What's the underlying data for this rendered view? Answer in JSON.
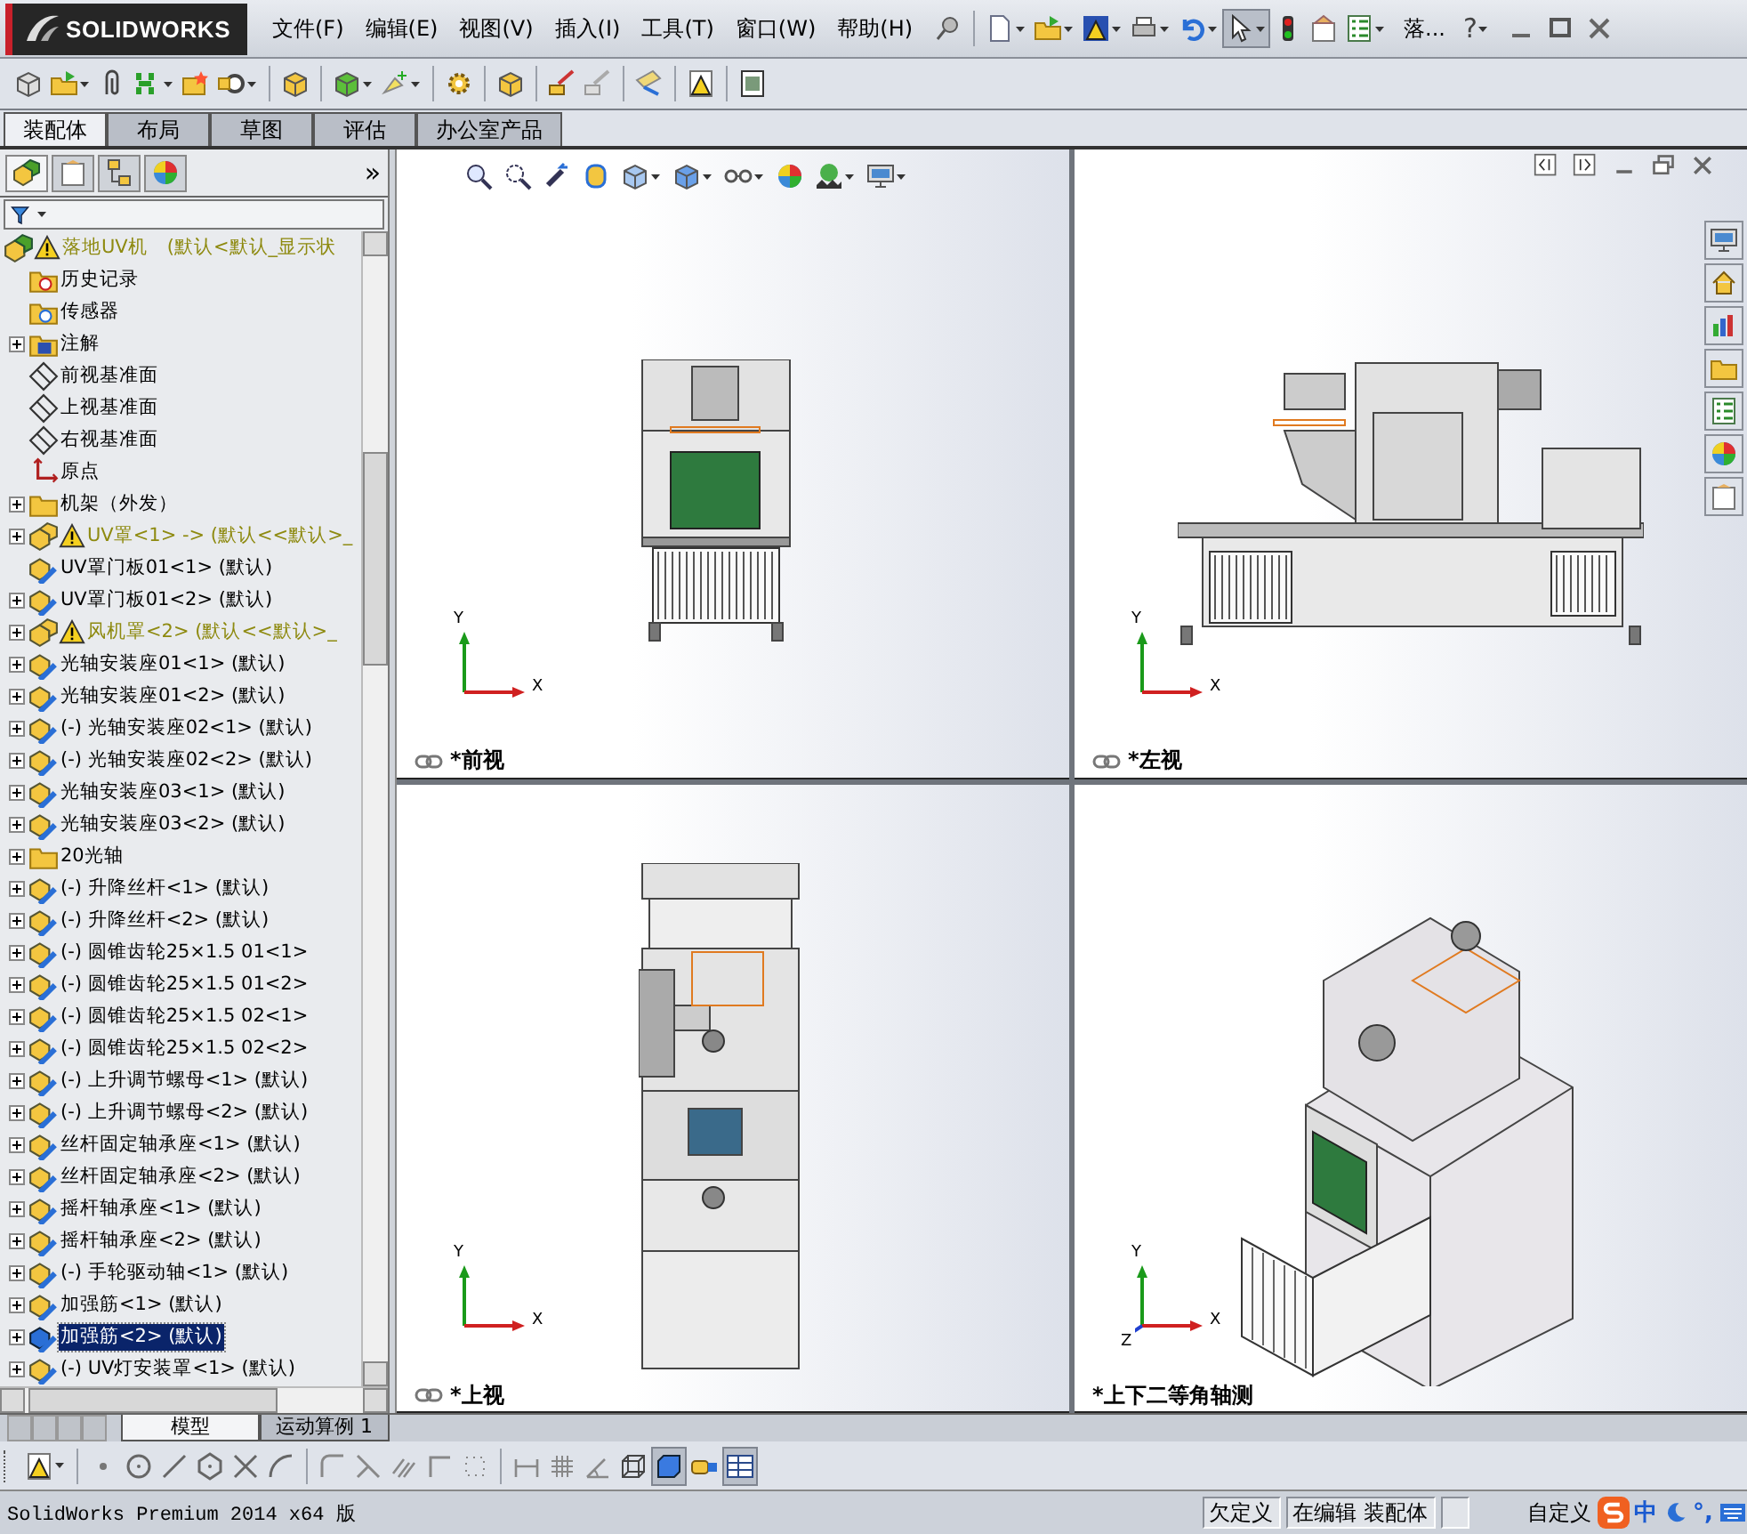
{
  "app": {
    "logo": "SOLIDWORKS"
  },
  "menu": [
    "文件(F)",
    "编辑(E)",
    "视图(V)",
    "插入(I)",
    "工具(T)",
    "窗口(W)",
    "帮助(H)"
  ],
  "title_toolbar": [
    [
      {
        "kind": "pin",
        "dropdown": false,
        "pressed": false
      }
    ],
    [
      {
        "kind": "doc",
        "dropdown": true,
        "pressed": false
      },
      {
        "kind": "open-folder",
        "dropdown": true,
        "pressed": false
      },
      {
        "kind": "save-warn",
        "dropdown": true,
        "pressed": false
      },
      {
        "kind": "print",
        "dropdown": true,
        "pressed": false
      },
      {
        "kind": "undo",
        "dropdown": true,
        "pressed": false
      },
      {
        "kind": "pointer",
        "dropdown": true,
        "pressed": true
      },
      {
        "kind": "traffic",
        "dropdown": false,
        "pressed": false
      },
      {
        "kind": "options",
        "dropdown": false,
        "pressed": false
      },
      {
        "kind": "list",
        "dropdown": true,
        "pressed": false
      }
    ]
  ],
  "document_title": "落...",
  "help": "?",
  "command_toolbar": [
    [
      {
        "kind": "gray-box",
        "dropdown": false,
        "pressed": false
      },
      {
        "kind": "open-folder",
        "dropdown": true,
        "pressed": false
      },
      {
        "kind": "clip",
        "dropdown": false,
        "pressed": false
      },
      {
        "kind": "pattern",
        "dropdown": true,
        "pressed": false
      },
      {
        "kind": "star-folder",
        "dropdown": false,
        "pressed": false
      },
      {
        "kind": "mate",
        "dropdown": true,
        "pressed": false
      }
    ],
    [
      {
        "kind": "yellow-cube",
        "dropdown": false,
        "pressed": false
      }
    ],
    [
      {
        "kind": "green-cube",
        "dropdown": true,
        "pressed": false
      },
      {
        "kind": "spark",
        "dropdown": true,
        "pressed": false
      }
    ],
    [
      {
        "kind": "gear",
        "dropdown": false,
        "pressed": false
      }
    ],
    [
      {
        "kind": "yellow-cube",
        "dropdown": false,
        "pressed": false
      }
    ],
    [
      {
        "kind": "move",
        "dropdown": false,
        "pressed": false
      },
      {
        "kind": "move-gray",
        "dropdown": false,
        "pressed": false
      }
    ],
    [
      {
        "kind": "measure",
        "dropdown": false,
        "pressed": false
      }
    ],
    [
      {
        "kind": "warn-doc",
        "dropdown": false,
        "pressed": false
      }
    ],
    [
      {
        "kind": "screenshot",
        "dropdown": false,
        "pressed": false
      }
    ]
  ],
  "command_tabs": [
    {
      "label": "装配体",
      "selected": true
    },
    {
      "label": "布局",
      "selected": false
    },
    {
      "label": "草图",
      "selected": false
    },
    {
      "label": "评估",
      "selected": false
    },
    {
      "label": "办公室产品",
      "selected": false
    }
  ],
  "panel_tabs": [
    {
      "kind": "assembly-root",
      "selected": true
    },
    {
      "kind": "notes",
      "selected": false
    },
    {
      "kind": "config",
      "selected": false
    },
    {
      "kind": "sphere",
      "selected": false
    }
  ],
  "panel_more": "»",
  "tree": {
    "label": "落地UV机　(默认<默认_显示状",
    "kind": "assembly-root",
    "warning": true,
    "children": [
      {
        "label": "历史记录",
        "kind": "history",
        "expandable": false,
        "warning": false,
        "selected": false
      },
      {
        "label": "传感器",
        "kind": "sensor",
        "expandable": false,
        "warning": false,
        "selected": false
      },
      {
        "label": "注解",
        "kind": "annotation",
        "expandable": true,
        "warning": false,
        "selected": false
      },
      {
        "label": "前视基准面",
        "kind": "plane",
        "expandable": false,
        "warning": false,
        "selected": false
      },
      {
        "label": "上视基准面",
        "kind": "plane",
        "expandable": false,
        "warning": false,
        "selected": false
      },
      {
        "label": "右视基准面",
        "kind": "plane",
        "expandable": false,
        "warning": false,
        "selected": false
      },
      {
        "label": "原点",
        "kind": "origin",
        "expandable": false,
        "warning": false,
        "selected": false
      },
      {
        "label": "机架（外发）",
        "kind": "folder",
        "expandable": true,
        "warning": false,
        "selected": false
      },
      {
        "label": "UV罩<1> -> (默认<<默认>_",
        "kind": "assembly",
        "expandable": true,
        "warning": true,
        "selected": false
      },
      {
        "label": "UV罩门板01<1> (默认)",
        "kind": "part",
        "expandable": false,
        "warning": false,
        "selected": false
      },
      {
        "label": "UV罩门板01<2> (默认)",
        "kind": "part",
        "expandable": true,
        "warning": false,
        "selected": false
      },
      {
        "label": "风机罩<2> (默认<<默认>_",
        "kind": "assembly",
        "expandable": true,
        "warning": true,
        "selected": false
      },
      {
        "label": "光轴安装座01<1> (默认)",
        "kind": "part",
        "expandable": true,
        "warning": false,
        "selected": false
      },
      {
        "label": "光轴安装座01<2> (默认)",
        "kind": "part",
        "expandable": true,
        "warning": false,
        "selected": false
      },
      {
        "label": "(-) 光轴安装座02<1> (默认)",
        "kind": "part",
        "expandable": true,
        "warning": false,
        "selected": false
      },
      {
        "label": "(-) 光轴安装座02<2> (默认)",
        "kind": "part",
        "expandable": true,
        "warning": false,
        "selected": false
      },
      {
        "label": "光轴安装座03<1> (默认)",
        "kind": "part",
        "expandable": true,
        "warning": false,
        "selected": false
      },
      {
        "label": "光轴安装座03<2> (默认)",
        "kind": "part",
        "expandable": true,
        "warning": false,
        "selected": false
      },
      {
        "label": "20光轴",
        "kind": "folder",
        "expandable": true,
        "warning": false,
        "selected": false
      },
      {
        "label": "(-) 升降丝杆<1> (默认)",
        "kind": "part",
        "expandable": true,
        "warning": false,
        "selected": false
      },
      {
        "label": "(-) 升降丝杆<2> (默认)",
        "kind": "part",
        "expandable": true,
        "warning": false,
        "selected": false
      },
      {
        "label": "(-) 圆锥齿轮25×1.5 01<1>",
        "kind": "part",
        "expandable": true,
        "warning": false,
        "selected": false
      },
      {
        "label": "(-) 圆锥齿轮25×1.5 01<2>",
        "kind": "part",
        "expandable": true,
        "warning": false,
        "selected": false
      },
      {
        "label": "(-) 圆锥齿轮25×1.5 02<1>",
        "kind": "part",
        "expandable": true,
        "warning": false,
        "selected": false
      },
      {
        "label": "(-) 圆锥齿轮25×1.5 02<2>",
        "kind": "part",
        "expandable": true,
        "warning": false,
        "selected": false
      },
      {
        "label": "(-) 上升调节螺母<1> (默认)",
        "kind": "part",
        "expandable": true,
        "warning": false,
        "selected": false
      },
      {
        "label": "(-) 上升调节螺母<2> (默认)",
        "kind": "part",
        "expandable": true,
        "warning": false,
        "selected": false
      },
      {
        "label": "丝杆固定轴承座<1> (默认)",
        "kind": "part",
        "expandable": true,
        "warning": false,
        "selected": false
      },
      {
        "label": "丝杆固定轴承座<2> (默认)",
        "kind": "part",
        "expandable": true,
        "warning": false,
        "selected": false
      },
      {
        "label": "摇杆轴承座<1> (默认)",
        "kind": "part",
        "expandable": true,
        "warning": false,
        "selected": false
      },
      {
        "label": "摇杆轴承座<2> (默认)",
        "kind": "part",
        "expandable": true,
        "warning": false,
        "selected": false
      },
      {
        "label": "(-) 手轮驱动轴<1> (默认)",
        "kind": "part",
        "expandable": true,
        "warning": false,
        "selected": false
      },
      {
        "label": "加强筋<1> (默认)",
        "kind": "part",
        "expandable": true,
        "warning": false,
        "selected": false
      },
      {
        "label": "加强筋<2> (默认)",
        "kind": "part",
        "expandable": true,
        "warning": false,
        "selected": true
      },
      {
        "label": "(-) UV灯安装罩<1> (默认)",
        "kind": "part",
        "expandable": true,
        "warning": false,
        "selected": false
      }
    ]
  },
  "heads_up_toolbar": [
    {
      "kind": "zoom",
      "dropdown": false,
      "pressed": false
    },
    {
      "kind": "zoom-area",
      "dropdown": false,
      "pressed": false
    },
    {
      "kind": "prev-view",
      "dropdown": false,
      "pressed": false
    },
    {
      "kind": "section",
      "dropdown": false,
      "pressed": false
    },
    {
      "kind": "view-cube",
      "dropdown": true,
      "pressed": false
    },
    {
      "kind": "shaded-cube",
      "dropdown": true,
      "pressed": false
    },
    {
      "kind": "glasses",
      "dropdown": true,
      "pressed": false
    },
    {
      "kind": "sphere",
      "dropdown": false,
      "pressed": false
    },
    {
      "kind": "scene",
      "dropdown": true,
      "pressed": false
    },
    {
      "kind": "monitor",
      "dropdown": true,
      "pressed": false
    }
  ],
  "viewports": [
    {
      "label": "*前视",
      "linked": true,
      "kind": "front",
      "axes": [
        "Y",
        "X"
      ]
    },
    {
      "label": "*左视",
      "linked": true,
      "kind": "left",
      "axes": [
        "Y",
        "X"
      ]
    },
    {
      "label": "*上视",
      "linked": true,
      "kind": "top",
      "axes": [
        "Y",
        "X"
      ]
    },
    {
      "label": "*上下二等角轴测",
      "linked": false,
      "kind": "iso",
      "axes": [
        "Y",
        "X",
        "Z"
      ]
    }
  ],
  "bottom_tabs": [
    {
      "label": "模型",
      "selected": true
    },
    {
      "label": "运动算例 1",
      "selected": false
    }
  ],
  "sketch_toolbar": [
    [
      {
        "kind": "warn-doc",
        "dropdown": true,
        "pressed": false
      }
    ],
    [
      {
        "kind": "dot",
        "dropdown": false,
        "pressed": false
      },
      {
        "kind": "circle",
        "dropdown": false,
        "pressed": false
      },
      {
        "kind": "line",
        "dropdown": false,
        "pressed": false
      },
      {
        "kind": "polygon",
        "dropdown": false,
        "pressed": false
      },
      {
        "kind": "cross",
        "dropdown": false,
        "pressed": false
      },
      {
        "kind": "arc",
        "dropdown": false,
        "pressed": false
      }
    ],
    [
      {
        "kind": "fillet",
        "dropdown": false,
        "pressed": false
      },
      {
        "kind": "trim",
        "dropdown": false,
        "pressed": false
      },
      {
        "kind": "offset",
        "dropdown": false,
        "pressed": false
      },
      {
        "kind": "corner",
        "dropdown": false,
        "pressed": false
      },
      {
        "kind": "dots",
        "dropdown": false,
        "pressed": false
      }
    ],
    [
      {
        "kind": "dimension",
        "dropdown": false,
        "pressed": false
      },
      {
        "kind": "hatch",
        "dropdown": false,
        "pressed": false
      },
      {
        "kind": "angle",
        "dropdown": false,
        "pressed": false
      },
      {
        "kind": "wire-cube",
        "dropdown": false,
        "pressed": false
      },
      {
        "kind": "solid-cube",
        "dropdown": false,
        "pressed": true
      },
      {
        "kind": "tape",
        "dropdown": false,
        "pressed": false
      },
      {
        "kind": "table",
        "dropdown": false,
        "pressed": true
      }
    ]
  ],
  "status_bar": {
    "product": "SolidWorks Premium 2014 x64 版",
    "fields": [
      "欠定义",
      "在编辑 装配体"
    ],
    "custom": "自定义",
    "ime_language": "中",
    "ime_punctuation": "°,"
  }
}
